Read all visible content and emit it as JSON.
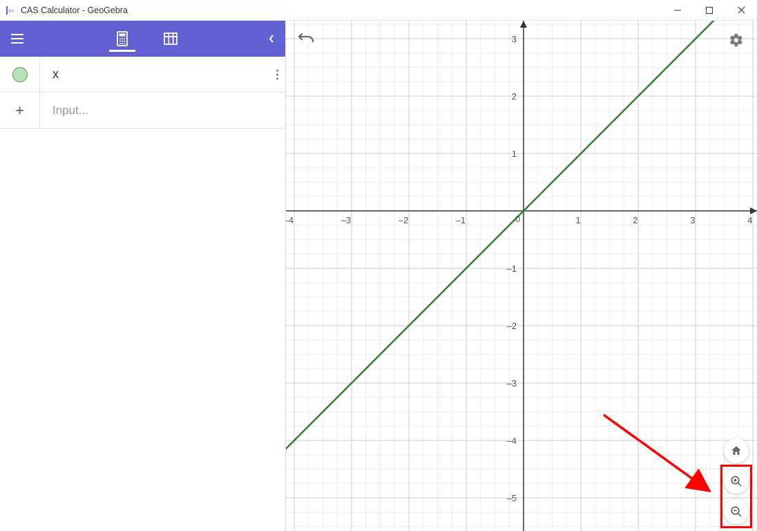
{
  "window": {
    "title": "CAS Calculator - GeoGebra"
  },
  "sidebar": {
    "row1_expression": "x",
    "input_placeholder": "Input..."
  },
  "chart_data": {
    "type": "line",
    "title": "",
    "xlabel": "",
    "ylabel": "",
    "xlim": [
      -4,
      4
    ],
    "ylim": [
      -5,
      3
    ],
    "x_ticks": [
      -4,
      -3,
      -2,
      -1,
      0,
      1,
      2,
      3,
      4
    ],
    "y_ticks": [
      -5,
      -4,
      -3,
      -2,
      -1,
      1,
      2,
      3
    ],
    "grid": true,
    "series": [
      {
        "name": "x",
        "color": "#2e7d32",
        "x": [
          -4,
          4
        ],
        "y": [
          -4,
          4
        ]
      }
    ]
  },
  "annotation": {
    "highlight_target": "zoom-controls"
  }
}
